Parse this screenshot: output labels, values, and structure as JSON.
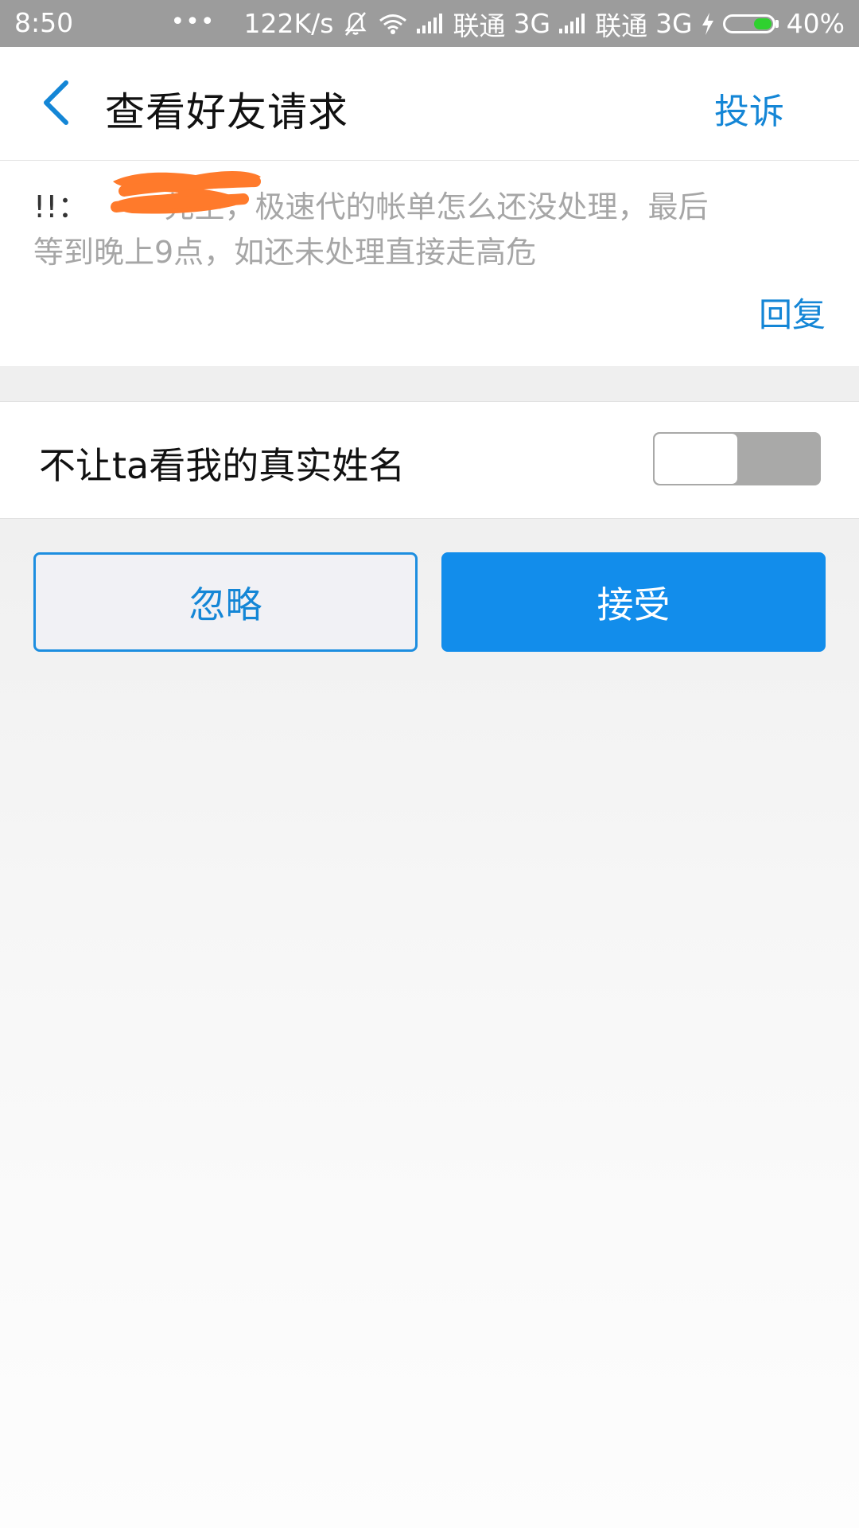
{
  "status_bar": {
    "time": "8:50",
    "more_dots": "•••",
    "net_speed": "122K/s",
    "carrier1": "联通",
    "network1": "3G",
    "carrier2": "联通",
    "network2": "3G",
    "battery_percent": "40%",
    "battery_level": 0.4,
    "battery_color": "#2fd12f"
  },
  "header": {
    "title": "查看好友请求",
    "report_label": "投诉",
    "accent_color": "#1486d6"
  },
  "message": {
    "sender": "!!：",
    "line1": "先生，极速代的帐单怎么还没处理，最后",
    "line2": "等到晚上9点，如还未处理直接走高危",
    "reply_label": "回复",
    "redaction_color": "#ff7a2b"
  },
  "privacy": {
    "label": "不让ta看我的真实姓名",
    "toggle_on": false
  },
  "actions": {
    "ignore_label": "忽略",
    "accept_label": "接受",
    "primary_color": "#128deb"
  }
}
